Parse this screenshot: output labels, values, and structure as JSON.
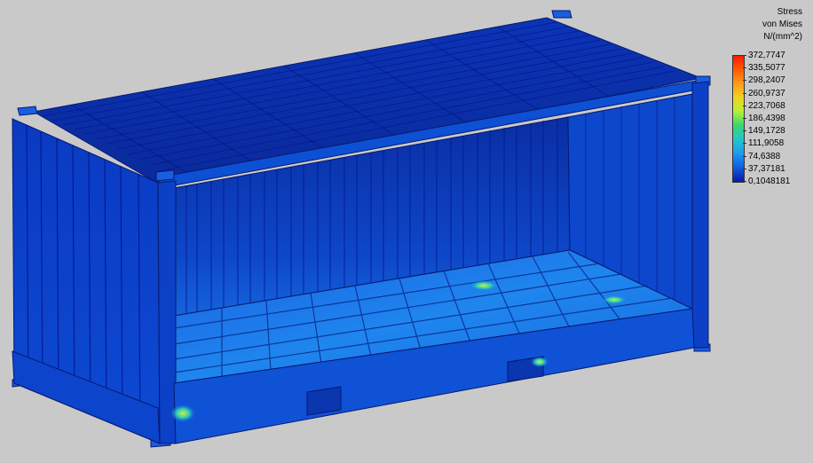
{
  "legend": {
    "title_line1": "Stress",
    "title_line2": "von Mises",
    "title_line3": "N/(mm^2)",
    "ticks": [
      "372,7747",
      "335,5077",
      "298,2407",
      "260,9737",
      "223,7068",
      "186,4398",
      "149,1728",
      "111,9058",
      "74,6388",
      "37,37181",
      "0,1048181"
    ],
    "max_value": 372.7747,
    "min_value": 0.1048181,
    "colors_top_to_bottom": [
      "#ff1a00",
      "#ff5a00",
      "#ff9b1a",
      "#f2d21a",
      "#b8f03a",
      "#3cd66e",
      "#20c8c8",
      "#1e9cf0",
      "#1060e0",
      "#0a1aa8"
    ]
  },
  "model": {
    "background": "#c9c9c9",
    "body_color": "#0b3bc8",
    "panel_color": "#0a2fa8",
    "floor_color": "#1e78e6",
    "hotspot_color": "#b8f03a"
  }
}
